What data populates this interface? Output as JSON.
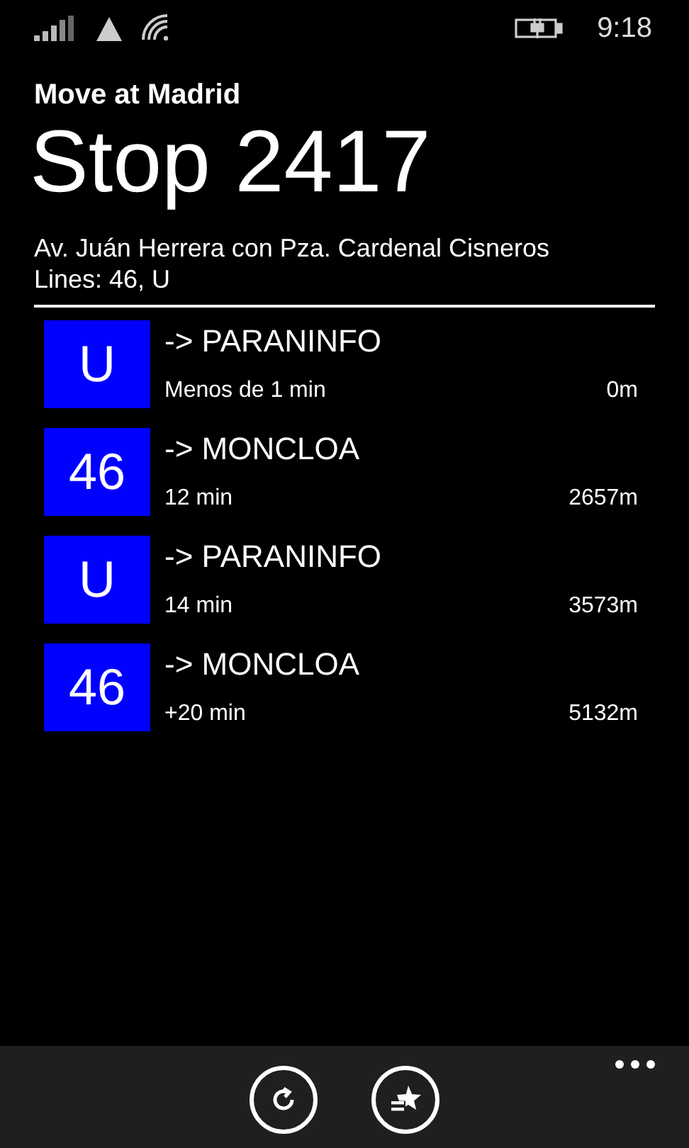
{
  "status_bar": {
    "time": "9:18"
  },
  "app_name": "Move at Madrid",
  "title": "Stop 2417",
  "address": "Av. Juán Herrera con Pza. Cardenal Cisneros",
  "lines": "Lines: 46, U",
  "arrivals": [
    {
      "line": "U",
      "color": "#0000ff",
      "destination": "-> PARANINFO",
      "time": "Menos de 1 min",
      "distance": "0m"
    },
    {
      "line": "46",
      "color": "#0000ff",
      "destination": "-> MONCLOA",
      "time": "12 min",
      "distance": "2657m"
    },
    {
      "line": "U",
      "color": "#0000ff",
      "destination": "-> PARANINFO",
      "time": "14 min",
      "distance": "3573m"
    },
    {
      "line": "46",
      "color": "#0000ff",
      "destination": "-> MONCLOA",
      "time": "+20 min",
      "distance": "5132m"
    }
  ],
  "app_bar": {
    "buttons": [
      {
        "kind": "refresh"
      },
      {
        "kind": "favorite"
      }
    ]
  }
}
